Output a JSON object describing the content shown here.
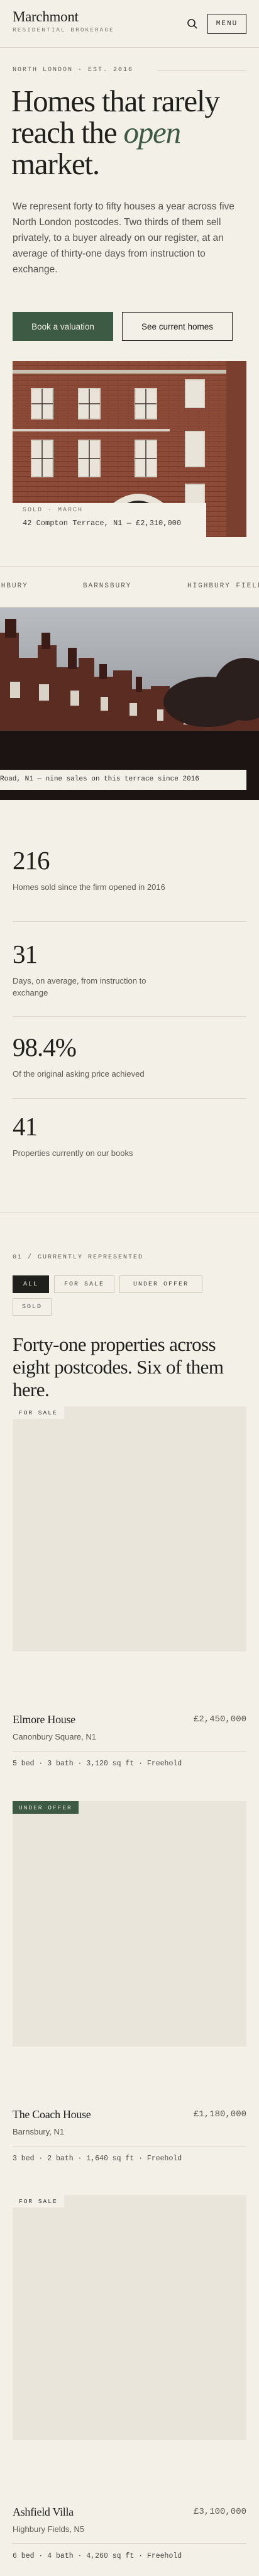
{
  "header": {
    "logo": "Marchmont",
    "tagline": "RESIDENTIAL BROKERAGE",
    "search_icon": "search-icon",
    "menu_label": "MENU"
  },
  "hero": {
    "eyebrow": "NORTH LONDON · EST. 2016",
    "headline_pre": "Homes that rarely reach the ",
    "headline_em": "open",
    "headline_post": " market.",
    "intro": "We represent forty to fifty houses a year across five North London postcodes. Two thirds of them sell privately, to a buyer already on our register, at an average of thirty-one days from instruction to exchange.",
    "primary_cta": "Book a valuation",
    "secondary_cta": "See current homes"
  },
  "feature": {
    "label": "SOLD · MARCH",
    "address": "42 Compton Terrace, N1 — £2,310,000"
  },
  "ticker": {
    "items": [
      "HIGHBURY",
      "BARNSBURY",
      "HIGHBURY FIELDS"
    ]
  },
  "street": {
    "caption": "Road, N1 — nine sales on this terrace since 2016"
  },
  "stats": [
    {
      "value": "216",
      "label": "Homes sold since the firm opened in 2016"
    },
    {
      "value": "31",
      "label": "Days, on average, from instruction to exchange"
    },
    {
      "value": "98.4%",
      "label": "Of the original asking price achieved"
    },
    {
      "value": "41",
      "label": "Properties currently on our books"
    }
  ],
  "listings": {
    "eyebrow": "01  /  CURRENTLY REPRESENTED",
    "filters": [
      "ALL",
      "FOR SALE",
      "UNDER OFFER",
      "SOLD"
    ],
    "title": "Forty-one properties across eight postcodes. Six of them here.",
    "cards": [
      {
        "badge": "FOR SALE",
        "title": "Elmore House",
        "price": "£2,450,000",
        "area": "Canonbury Square, N1",
        "specs": "5 bed · 3 bath · 3,120 sq ft · Freehold"
      },
      {
        "badge": "UNDER OFFER",
        "title": "The Coach House",
        "price": "£1,180,000",
        "area": "Barnsbury, N1",
        "specs": "3 bed · 2 bath · 1,640 sq ft · Freehold"
      },
      {
        "badge": "FOR SALE",
        "title": "Ashfield Villa",
        "price": "£3,100,000",
        "area": "Highbury Fields, N5",
        "specs": "6 bed · 4 bath · 4,260 sq ft · Freehold"
      }
    ]
  },
  "colors": {
    "background": "#f3f0e8",
    "accent": "#3c5a44",
    "ink": "#1f1f1c",
    "brick": "#8a4a37"
  }
}
